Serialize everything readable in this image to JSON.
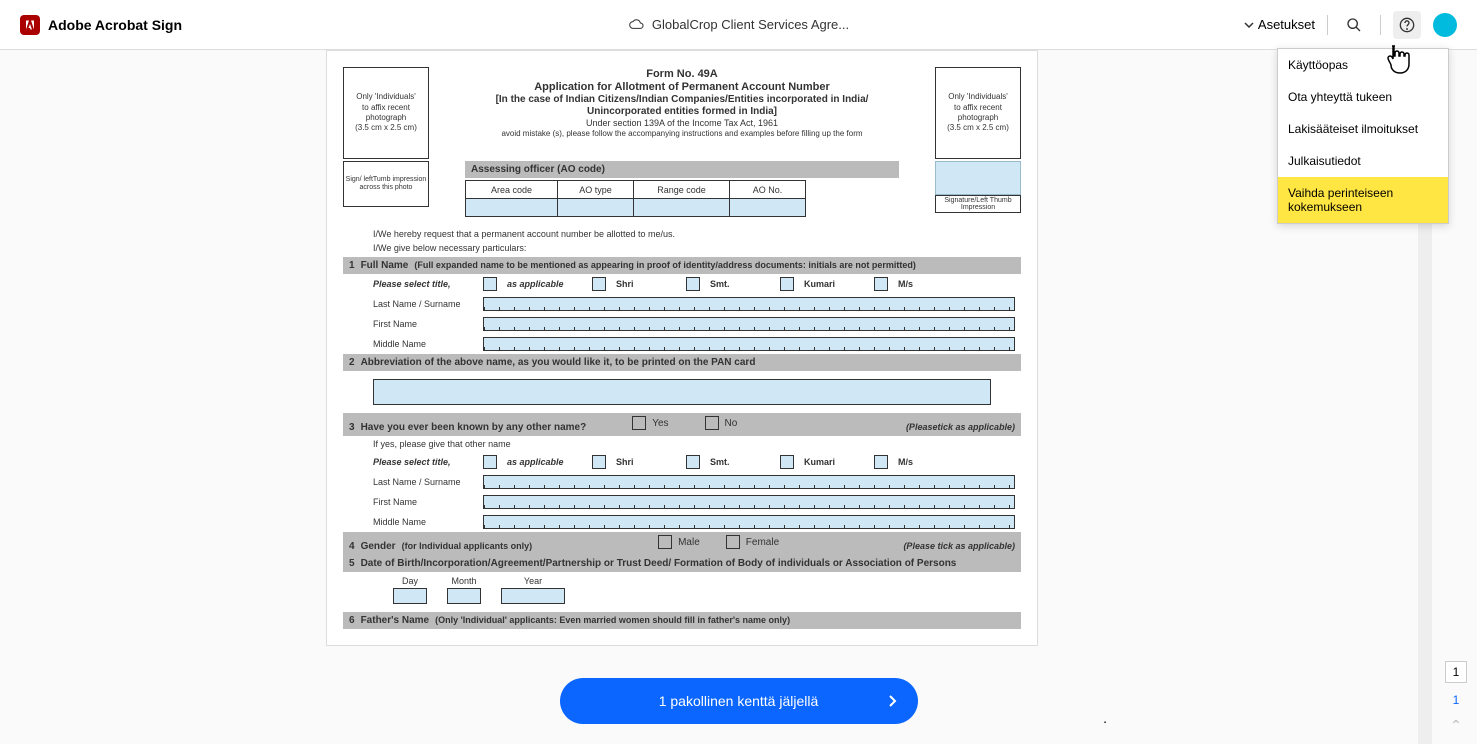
{
  "header": {
    "app_name": "Adobe Acrobat Sign",
    "doc_title": "GlobalCrop Client Services Agre...",
    "settings_label": "Asetukset"
  },
  "dropdown": {
    "items": [
      "Käyttöopas",
      "Ota yhteyttä tukeen",
      "Lakisääteiset ilmoitukset",
      "Julkaisutiedot",
      "Vaihda perinteiseen kokemukseen"
    ]
  },
  "document": {
    "form_no": "Form No. 49A",
    "title": "Application for Allotment of Permanent Account Number",
    "sub1": "[In the  case of Indian Citizens/Indian Companies/Entities incorporated in India/",
    "sub2": "Unincorporated entities formed in India]",
    "section": "Under section 139A of the Income Tax Act, 1961",
    "avoid": "avoid mistake (s), please follow the accompanying instructions and examples before filling up the form",
    "photo_text1": "Only 'Individuals'",
    "photo_text2": "to affix recent",
    "photo_text3": "photograph",
    "photo_text4": "(3.5 cm x 2.5 cm)",
    "sign_left": "Sign/ leftTumb impression across this photo",
    "sign_right": "Signature/Left Thumb Impression",
    "ao_header": "Assessing officer  (AO code)",
    "ao_cols": [
      "Area code",
      "AO type",
      "Range code",
      "AO No."
    ],
    "request1": "I/We hereby request that a permanent account number be allotted to me/us.",
    "request2": "I/We give below necessary particulars:",
    "s1": {
      "num": "1",
      "title": "Full Name",
      "hint": "(Full expanded name to be mentioned as appearing in proof of identity/address documents: initials are not permitted)"
    },
    "select_title": "Please select title,",
    "as_applicable": "as applicable",
    "titles": [
      "Shri",
      "Smt.",
      "Kumari",
      "M/s"
    ],
    "last_name": "Last Name / Surname",
    "first_name": "First Name",
    "middle_name": "Middle Name",
    "s2": {
      "num": "2",
      "title": "Abbreviation of the above name, as you would like it, to be printed on the PAN card"
    },
    "s3": {
      "num": "3",
      "title": "Have you ever been known by any other name?",
      "yes": "Yes",
      "no": "No",
      "hint": "(Pleasetick as applicable)"
    },
    "if_yes": "If yes, please give that other name",
    "s4": {
      "num": "4",
      "title": "Gender",
      "hint": "(for Individual applicants only)",
      "male": "Male",
      "female": "Female",
      "tick": "(Please tick as applicable)"
    },
    "s5": {
      "num": "5",
      "title": "Date of Birth/Incorporation/Agreement/Partnership or Trust Deed/ Formation of Body of individuals or Association of Persons"
    },
    "date_day": "Day",
    "date_month": "Month",
    "date_year": "Year",
    "s6": {
      "num": "6",
      "title": "Father's Name",
      "hint": "(Only 'Individual' applicants: Even married women should fill in father's name only)"
    }
  },
  "pill": {
    "text": "1 pakollinen kenttä jäljellä"
  },
  "page_indicator": {
    "current": "1",
    "total": "1"
  }
}
